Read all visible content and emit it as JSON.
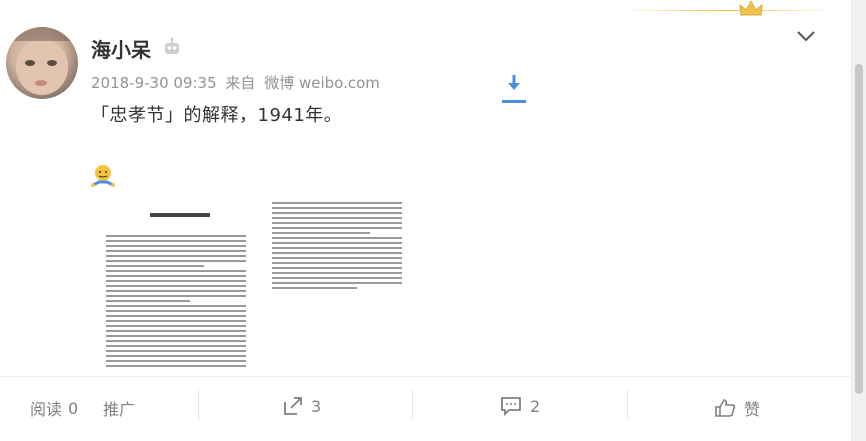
{
  "post": {
    "author": "海小呆",
    "date": "2018-9-30 09:35",
    "from_label": "来自",
    "source": "微博 weibo.com",
    "text": "「忠孝节」的解释，1941年。"
  },
  "actions": {
    "read_label": "阅读",
    "read_count": "0",
    "promote_label": "推广",
    "repost_count": "3",
    "comment_count": "2",
    "like_label": "赞"
  },
  "colors": {
    "accent_blue": "#4a8fe0",
    "meta_gray": "#939393",
    "gold": "#f0c450"
  },
  "icons": [
    "robot-icon",
    "chevron-down-icon",
    "download-icon",
    "crown-icon",
    "emoji-icon",
    "repost-icon",
    "comment-icon",
    "like-icon"
  ]
}
